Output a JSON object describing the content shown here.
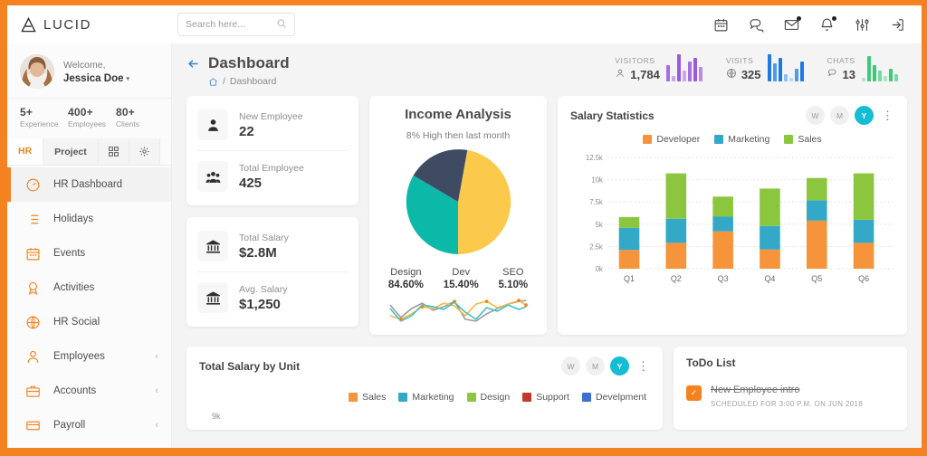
{
  "brand": {
    "name": "LUCID",
    "logo_icon": "lucid-triangle-logo",
    "accent": "#f58220"
  },
  "topbar": {
    "search": {
      "placeholder": "Search here...",
      "value": "",
      "icon": "search-icon"
    },
    "icons": [
      {
        "name": "calendar-icon",
        "badge": false
      },
      {
        "name": "chat-icon",
        "badge": false
      },
      {
        "name": "mail-icon",
        "badge": true
      },
      {
        "name": "bell-icon",
        "badge": true
      },
      {
        "name": "sliders-icon",
        "badge": false
      },
      {
        "name": "logout-icon",
        "badge": false
      }
    ]
  },
  "sidebar": {
    "profile": {
      "greeting": "Welcome,",
      "name": "Jessica Doe",
      "avatar": "user-avatar",
      "caret": "▾"
    },
    "stats": [
      {
        "value": "5+",
        "label": "Experience"
      },
      {
        "value": "400+",
        "label": "Employees"
      },
      {
        "value": "80+",
        "label": "Clients"
      }
    ],
    "tabs": [
      {
        "label": "HR",
        "active": true
      },
      {
        "label": "Project",
        "active": false
      },
      {
        "label": "",
        "icon": "grid-icon",
        "active": false
      },
      {
        "label": "",
        "icon": "gear-icon",
        "active": false
      }
    ],
    "menu": [
      {
        "label": "HR Dashboard",
        "icon": "gauge-icon",
        "active": true,
        "expandable": false
      },
      {
        "label": "Holidays",
        "icon": "list-icon",
        "active": false,
        "expandable": false
      },
      {
        "label": "Events",
        "icon": "calendar-icon",
        "active": false,
        "expandable": false
      },
      {
        "label": "Activities",
        "icon": "award-icon",
        "active": false,
        "expandable": false
      },
      {
        "label": "HR Social",
        "icon": "globe-icon",
        "active": false,
        "expandable": false
      },
      {
        "label": "Employees",
        "icon": "user-icon",
        "active": false,
        "expandable": true
      },
      {
        "label": "Accounts",
        "icon": "briefcase-icon",
        "active": false,
        "expandable": true
      },
      {
        "label": "Payroll",
        "icon": "card-icon",
        "active": false,
        "expandable": true
      }
    ],
    "chevron": "‹"
  },
  "page": {
    "title": "Dashboard",
    "back_icon": "back-arrow-icon",
    "breadcrumb": {
      "home_icon": "home-icon",
      "separator": "/",
      "current": "Dashboard"
    },
    "head_stats": [
      {
        "label": "VISITORS",
        "value": "1,784",
        "icon": "visitors-icon",
        "color": "#9b59e0",
        "bars": [
          18,
          6,
          30,
          12,
          22,
          26,
          16
        ]
      },
      {
        "label": "VISITS",
        "value": "325",
        "icon": "globe-icon",
        "color": "#1f7ae0",
        "bars": [
          30,
          20,
          26,
          8,
          4,
          14,
          22
        ]
      },
      {
        "label": "CHATS",
        "value": "13",
        "icon": "chat-icon",
        "color": "#3ec97a",
        "bars": [
          4,
          28,
          18,
          12,
          6,
          14,
          8
        ]
      }
    ]
  },
  "stat_cards": [
    {
      "label": "New Employee",
      "value": "22",
      "icon": "person-icon"
    },
    {
      "label": "Total Employee",
      "value": "425",
      "icon": "people-icon"
    },
    {
      "label": "Total Salary",
      "value": "$2.8M",
      "icon": "bank-icon"
    },
    {
      "label": "Avg. Salary",
      "value": "$1,250",
      "icon": "bank-icon"
    }
  ],
  "income": {
    "title": "Income Analysis",
    "subtitle": "8% High then last month"
  },
  "salary_stats": {
    "title": "Salary Statistics",
    "range_buttons": [
      {
        "label": "W",
        "active": false
      },
      {
        "label": "M",
        "active": false
      },
      {
        "label": "Y",
        "active": true
      }
    ],
    "menu_icon": "kebab-menu-icon"
  },
  "total_salary_by_unit": {
    "title": "Total Salary by Unit",
    "range_buttons": [
      {
        "label": "W",
        "active": false
      },
      {
        "label": "M",
        "active": false
      },
      {
        "label": "Y",
        "active": true
      }
    ],
    "menu_icon": "kebab-menu-icon",
    "axis_top_label": "9k",
    "legend": [
      {
        "name": "Sales",
        "color": "#f5943b"
      },
      {
        "name": "Marketing",
        "color": "#34a9c7"
      },
      {
        "name": "Design",
        "color": "#8cc63f"
      },
      {
        "name": "Support",
        "color": "#c0392b"
      },
      {
        "name": "Develpment",
        "color": "#3b6fd4"
      }
    ]
  },
  "todo": {
    "title": "ToDo List",
    "items": [
      {
        "label": "New Employee intro",
        "meta": "SCHEDULED FOR 3:00 P.M. ON JUN 2018",
        "done": true,
        "check": "✓"
      }
    ]
  },
  "chart_data": [
    {
      "type": "pie",
      "title": "Income Analysis",
      "subtitle": "8% High then last month",
      "labels": [
        "Design",
        "Dev",
        "SEO"
      ],
      "display_values": [
        "84.60%",
        "15.40%",
        "5.10%"
      ],
      "slice_fractions": [
        0.47,
        0.3,
        0.23
      ],
      "colors": [
        "#fbc94b",
        "#0cb8a8",
        "#3f4a63"
      ],
      "legend": "below",
      "note": "slice order clockwise from top: yellow, teal, navy"
    },
    {
      "type": "line",
      "title": "",
      "note": "sparkline under pie chart",
      "series": [
        {
          "name": "teal",
          "color": "#3fc0c6",
          "values": [
            6,
            3,
            5,
            8,
            7,
            6,
            9,
            5,
            3,
            7,
            6,
            8,
            5,
            7
          ]
        },
        {
          "name": "orange",
          "color": "#f5b942",
          "values": [
            4,
            6,
            4,
            7,
            6,
            8,
            6,
            4,
            7,
            9,
            6,
            8,
            9,
            7
          ]
        },
        {
          "name": "gray",
          "color": "#9a9a9a",
          "values": [
            8,
            4,
            3,
            3,
            6,
            9,
            9,
            3,
            2,
            2,
            5,
            7,
            8,
            9
          ]
        }
      ],
      "markers_color": "#f58220"
    },
    {
      "type": "bar",
      "stacked": true,
      "title": "Salary Statistics",
      "categories": [
        "Q1",
        "Q2",
        "Q3",
        "Q4",
        "Q5",
        "Q6"
      ],
      "series": [
        {
          "name": "Developer",
          "color": "#f5943b",
          "values": [
            2100,
            2900,
            4200,
            2150,
            5400,
            2900
          ]
        },
        {
          "name": "Marketing",
          "color": "#34a9c7",
          "values": [
            2500,
            2700,
            1650,
            2650,
            2300,
            2600
          ]
        },
        {
          "name": "Sales",
          "color": "#8cc63f",
          "values": [
            1200,
            5100,
            2250,
            4200,
            2500,
            5200
          ]
        }
      ],
      "ylabel": "",
      "xlabel": "",
      "ylim": [
        0,
        12500
      ],
      "yticks": [
        0,
        2500,
        5000,
        7500,
        10000,
        12500
      ],
      "ytick_labels": [
        "0k",
        "2.5k",
        "5k",
        "7.5k",
        "10k",
        "12.5k"
      ],
      "grid": true,
      "legend_position": "top-center"
    },
    {
      "type": "bar",
      "stacked": true,
      "title": "Total Salary by Unit",
      "categories": [],
      "ytick_labels": [
        "9k"
      ],
      "series": [
        {
          "name": "Sales",
          "color": "#f5943b",
          "values": []
        },
        {
          "name": "Marketing",
          "color": "#34a9c7",
          "values": []
        },
        {
          "name": "Design",
          "color": "#8cc63f",
          "values": []
        },
        {
          "name": "Support",
          "color": "#c0392b",
          "values": []
        },
        {
          "name": "Develpment",
          "color": "#3b6fd4",
          "values": []
        }
      ],
      "legend_position": "top-right",
      "note": "chart plot area cut off at bottom of screenshot"
    }
  ]
}
